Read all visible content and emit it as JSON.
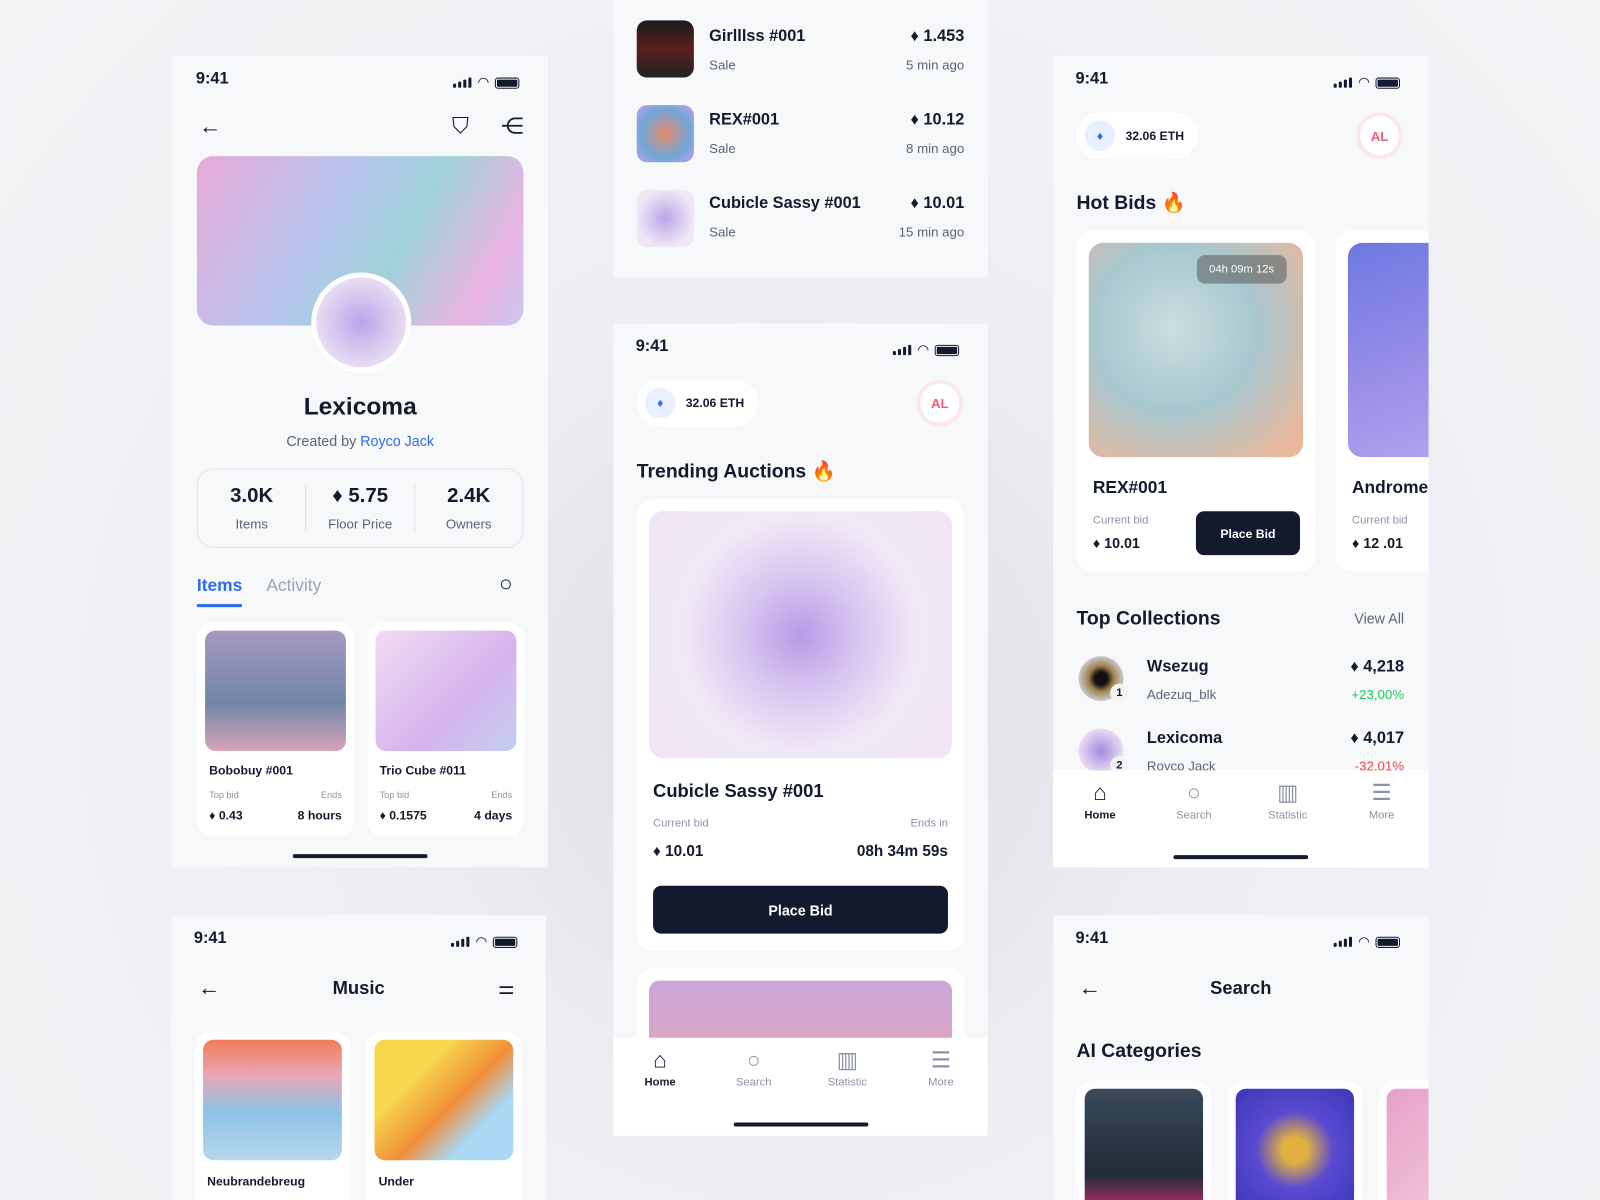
{
  "status": {
    "time": "9:41"
  },
  "profile": {
    "title": "Lexicoma",
    "created_by": "Created by",
    "creator": "Royco Jack",
    "stats": [
      {
        "value": "3.0K",
        "label": "Items"
      },
      {
        "value": "5.75",
        "label": "Floor Price"
      },
      {
        "value": "2.4K",
        "label": "Owners"
      }
    ],
    "tabs": [
      "Items",
      "Activity"
    ],
    "items": [
      {
        "name": "Bobobuy #001",
        "bid_label": "Top bid",
        "ends_label": "Ends",
        "bid": "0.43",
        "ends": "8 hours"
      },
      {
        "name": "Trio Cube #011",
        "bid_label": "Top bid",
        "ends_label": "Ends",
        "bid": "0.1575",
        "ends": "4 days"
      }
    ]
  },
  "activity": [
    {
      "name": "Girlllss #001",
      "type": "Sale",
      "price": "1.453",
      "time": "5 min ago"
    },
    {
      "name": "REX#001",
      "type": "Sale",
      "price": "10.12",
      "time": "8 min ago"
    },
    {
      "name": "Cubicle Sassy #001",
      "type": "Sale",
      "price": "10.01",
      "time": "15 min ago"
    }
  ],
  "wallet": {
    "balance": "32.06 ETH",
    "avatar": "AL"
  },
  "trending": {
    "title": "Trending Auctions 🔥",
    "name": "Cubicle Sassy #001",
    "bid_label": "Current bid",
    "ends_label": "Ends in",
    "bid": "10.01",
    "ends": "08h 34m 59s",
    "button": "Place Bid"
  },
  "nav": [
    "Home",
    "Search",
    "Statistic",
    "More"
  ],
  "hot": {
    "title": "Hot Bids 🔥",
    "cards": [
      {
        "name": "REX#001",
        "timer": "04h 09m 12s",
        "bid_label": "Current bid",
        "bid": "10.01",
        "button": "Place Bid"
      },
      {
        "name": "Andromeda",
        "bid_label": "Current bid",
        "bid": "12 .01"
      }
    ]
  },
  "collections": {
    "title": "Top Collections",
    "view_all": "View All",
    "rows": [
      {
        "rank": "1",
        "name": "Wsezug",
        "user": "Adezuq_blk",
        "value": "4,218",
        "change": "+23,00%"
      },
      {
        "rank": "2",
        "name": "Lexicoma",
        "user": "Royco Jack",
        "value": "4,017",
        "change": "-32,01%"
      }
    ]
  },
  "music": {
    "title": "Music",
    "items": [
      "Neubrandebreug",
      "Under"
    ]
  },
  "search": {
    "title": "Search",
    "section": "AI Categories"
  },
  "colors": {
    "accent": "#2f6bf0",
    "dark": "#141a2e",
    "positive": "#22c55e",
    "negative": "#ef4444"
  }
}
